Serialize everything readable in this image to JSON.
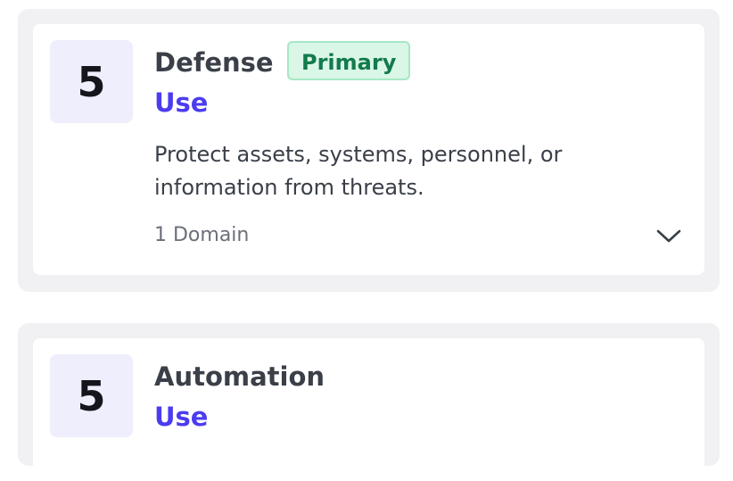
{
  "cards": [
    {
      "number": "5",
      "title": "Defense",
      "badge": "Primary",
      "subtitle": "Use",
      "description": "Protect assets, systems, personnel, or information from threats.",
      "domain_count": "1 Domain",
      "expand_icon": "chevron-down-icon"
    },
    {
      "number": "5",
      "title": "Automation",
      "subtitle": "Use"
    }
  ],
  "colors": {
    "accent": "#4b3cf0",
    "badge_bg": "#d9f6e7",
    "badge_text": "#137a4b",
    "number_bg": "#eeeefc",
    "outer_bg": "#f1f1f4"
  }
}
